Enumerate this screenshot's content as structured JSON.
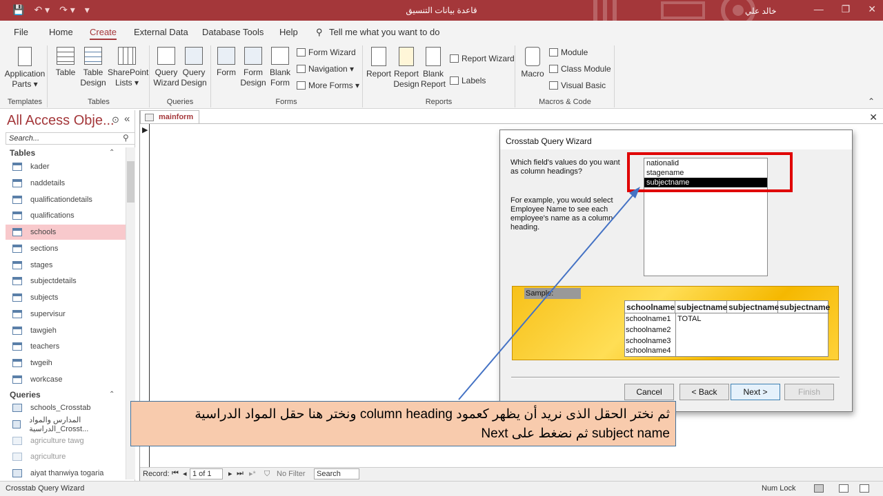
{
  "window": {
    "title": "قاعدة بيانات التنسيق",
    "user": "خالد علي",
    "minimize_glyph": "—",
    "restore_glyph": "❐",
    "close_glyph": "✕",
    "qat": {
      "save": "💾",
      "undo": "↶ ▾",
      "redo": "↷ ▾",
      "customize": "▾"
    }
  },
  "menu": {
    "file": "File",
    "home": "Home",
    "create": "Create",
    "external": "External Data",
    "dbtools": "Database Tools",
    "help": "Help",
    "tell": "Tell me what you want to do"
  },
  "ribbon": {
    "app_parts": "Application Parts ▾",
    "table": "Table",
    "table_design": "Table Design",
    "sharepoint": "SharePoint Lists ▾",
    "query_wizard": "Query Wizard",
    "query_design": "Query Design",
    "form": "Form",
    "form_design": "Form Design",
    "blank_form": "Blank Form",
    "form_wizard": "Form Wizard",
    "navigation": "Navigation ▾",
    "more_forms": "More Forms ▾",
    "report": "Report",
    "report_design": "Report Design",
    "blank_report": "Blank Report",
    "report_wizard": "Report Wizard",
    "labels": "Labels",
    "macro": "Macro",
    "module": "Module",
    "class_module": "Class Module",
    "visual_basic": "Visual Basic",
    "groups": {
      "templates": "Templates",
      "tables": "Tables",
      "queries": "Queries",
      "forms": "Forms",
      "reports": "Reports",
      "macros": "Macros & Code"
    }
  },
  "nav": {
    "title": "All Access Obje...",
    "search_placeholder": "Search...",
    "tables_header": "Tables",
    "queries_header": "Queries",
    "tables": [
      "kader",
      "naddetails",
      "qualificationdetails",
      "qualifications",
      "schools",
      "sections",
      "stages",
      "subjectdetails",
      "subjects",
      "supervisur",
      "tawgieh",
      "teachers",
      "twgeih",
      "workcase"
    ],
    "queries": [
      "schools_Crosstab",
      "المدارس والمواد الدراسية_Crosst...",
      "agriculture tawg",
      "agriculture",
      "aiyat thanwiya togaria"
    ]
  },
  "document": {
    "tab": "mainform",
    "close": "✕"
  },
  "recordbar": {
    "label": "Record:",
    "position": "1 of 1",
    "filter": "No Filter",
    "search": "Search"
  },
  "status": {
    "left": "Crosstab Query Wizard",
    "numlock": "Num Lock"
  },
  "dialog": {
    "title": "Crosstab Query Wizard",
    "question": "Which field's values do you want as column headings?",
    "example": "For example, you would select Employee Name to see each employee's name as a column heading.",
    "fields": [
      "nationalid",
      "stagename",
      "subjectname"
    ],
    "selected_field": "subjectname",
    "sample_label": "Sample:",
    "sample_headers": [
      "schoolname",
      "subjectname",
      "subjectname",
      "subjectname"
    ],
    "sample_rows": [
      "schoolname1",
      "schoolname2",
      "schoolname3",
      "schoolname4"
    ],
    "sample_total": "TOTAL",
    "buttons": {
      "cancel": "Cancel",
      "back": "< Back",
      "next": "Next >",
      "finish": "Finish"
    }
  },
  "callout": {
    "line1": "ثم نختر الحقل الذى نريد أن يظهر كعمود column heading ونختر هنا حقل المواد الدراسية",
    "line2": "subject name ثم نضغط على Next"
  },
  "colors": {
    "accent": "#a4373a",
    "highlight_box": "#e00000",
    "callout_bg": "#f8cbad",
    "arrow": "#4472c4"
  }
}
